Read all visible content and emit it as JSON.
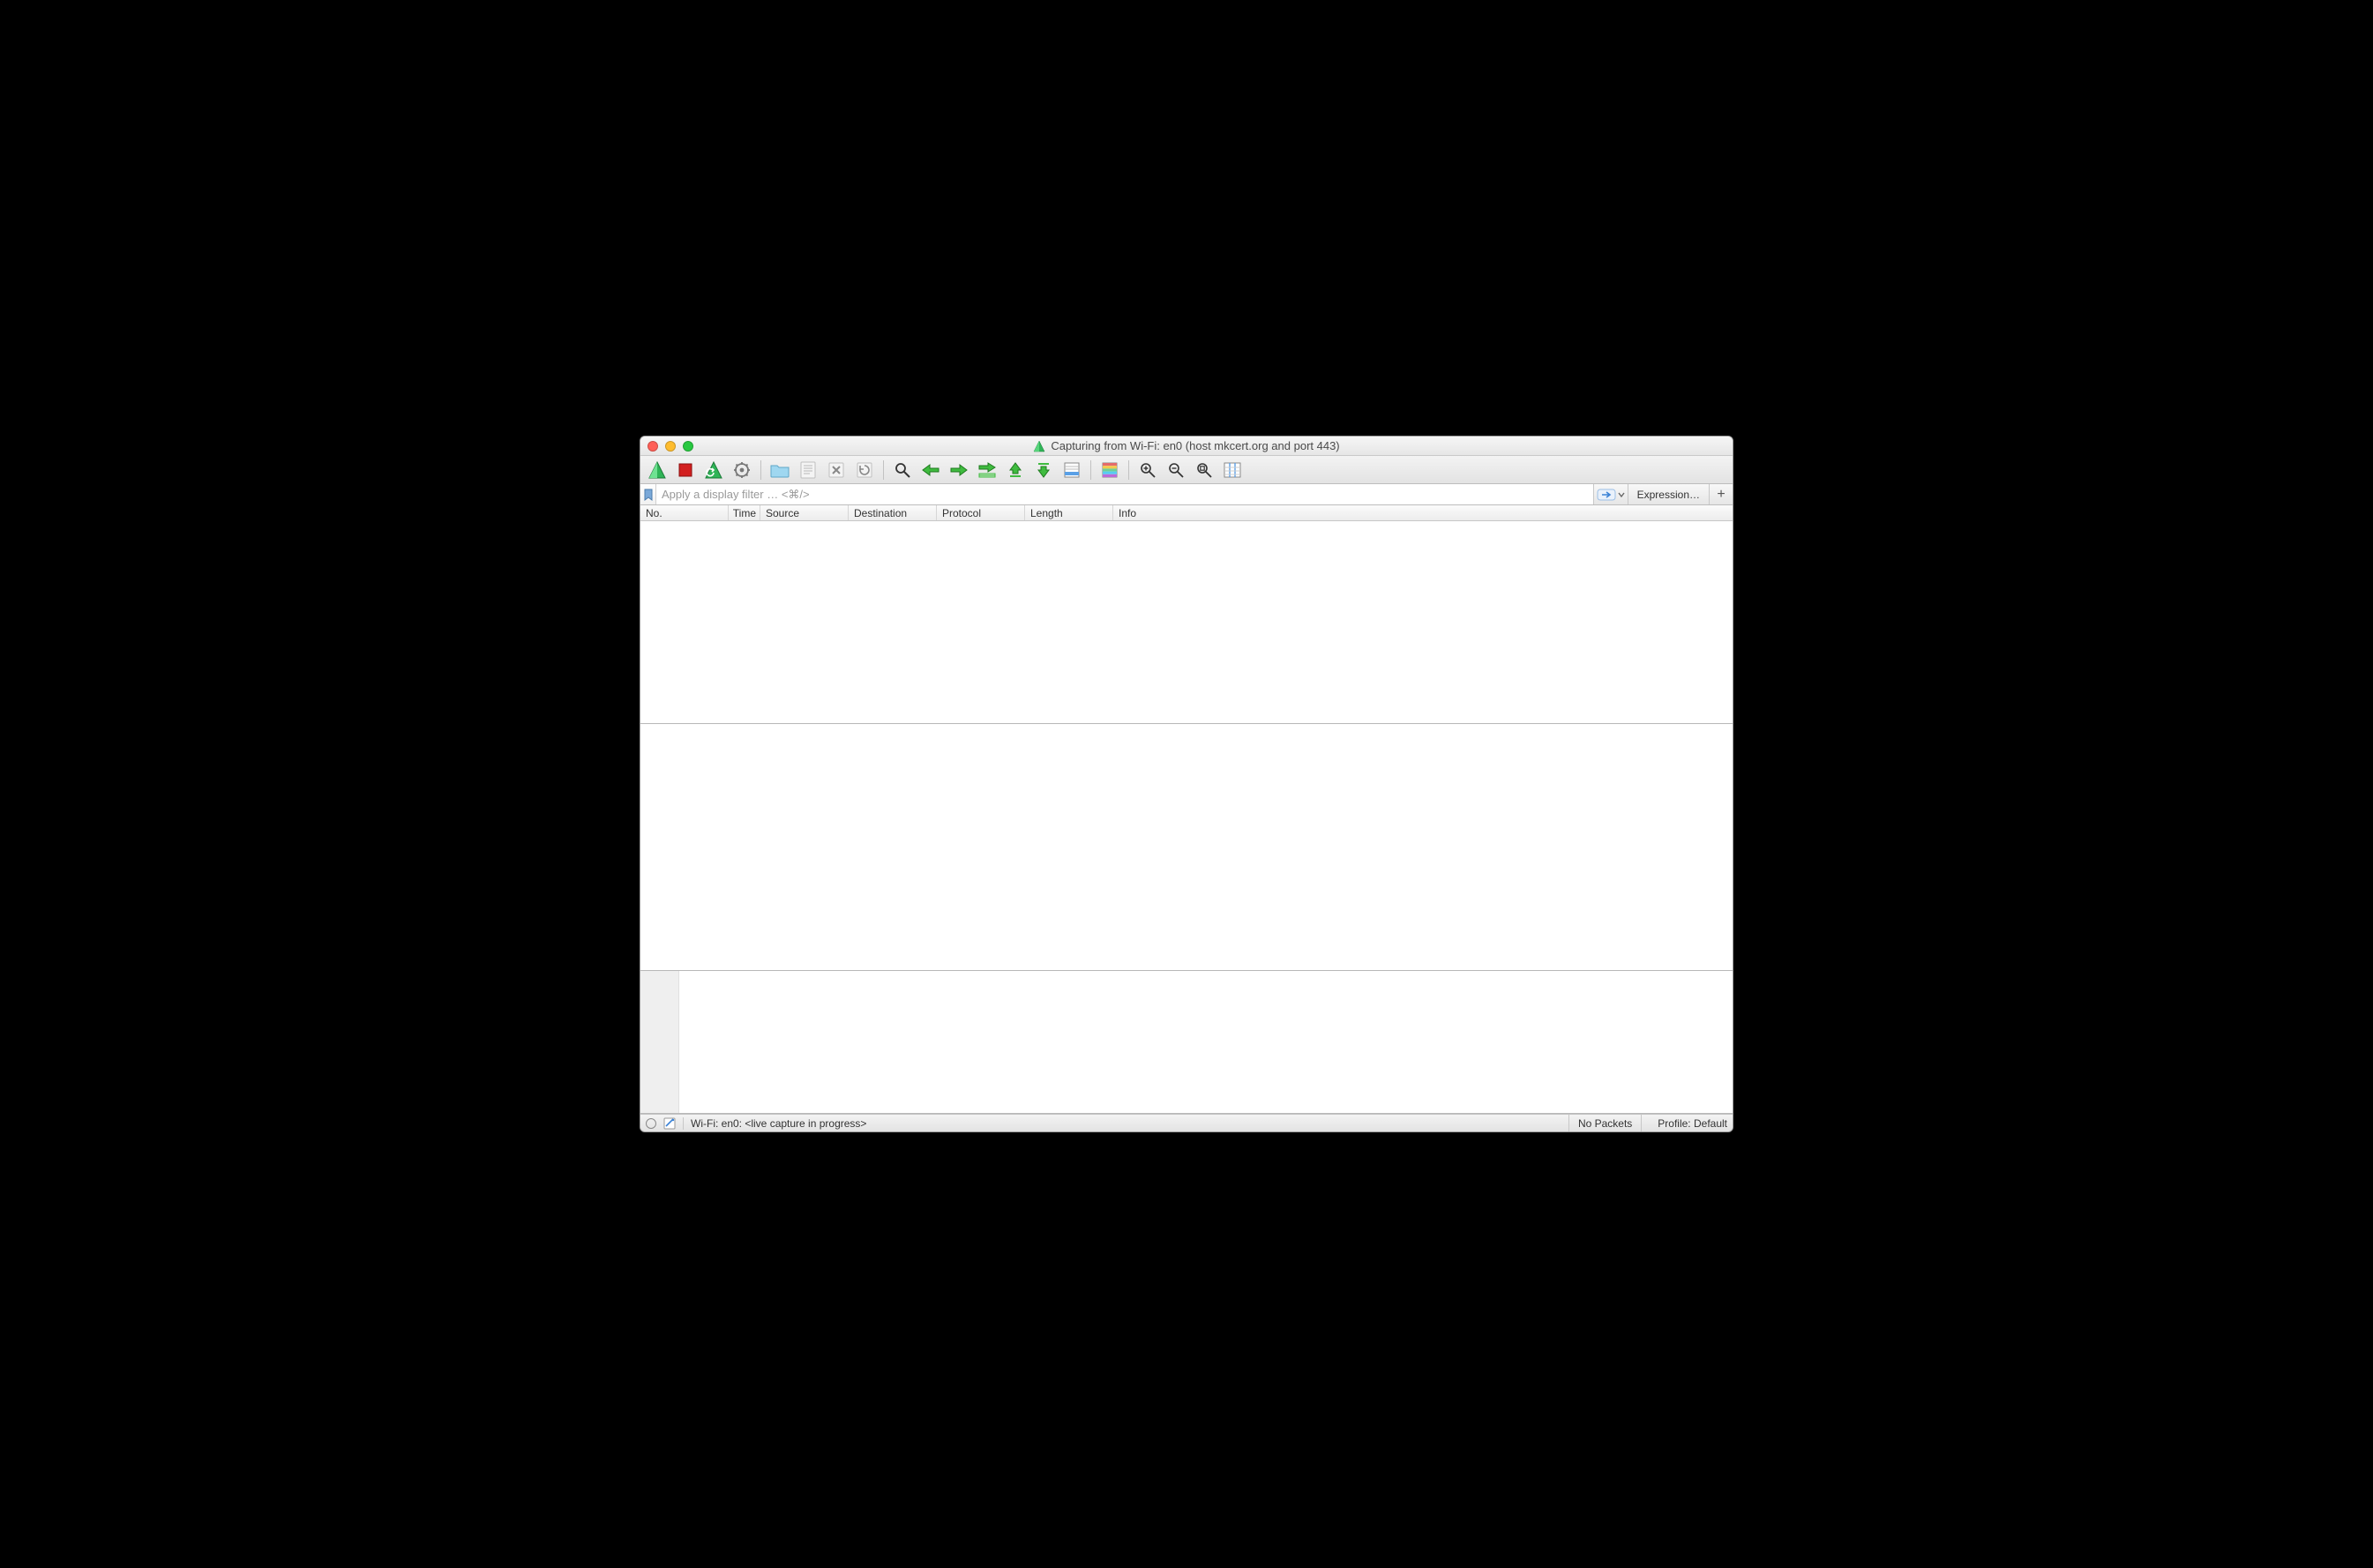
{
  "window": {
    "title": "Capturing from Wi-Fi: en0 (host mkcert.org and port 443)"
  },
  "toolbar": {
    "icons": {
      "start": "start-capture-icon",
      "stop": "stop-capture-icon",
      "restart": "restart-capture-icon",
      "options": "capture-options-icon",
      "open": "open-file-icon",
      "save": "save-file-icon",
      "close": "close-file-icon",
      "reload": "reload-file-icon",
      "find": "find-packet-icon",
      "prev": "go-prev-packet-icon",
      "next": "go-next-packet-icon",
      "jump": "go-to-packet-icon",
      "first": "go-first-packet-icon",
      "last": "go-last-packet-icon",
      "autoscroll": "autoscroll-icon",
      "colorize": "colorize-icon",
      "zoomin": "zoom-in-icon",
      "zoomout": "zoom-out-icon",
      "zoomreset": "zoom-reset-icon",
      "resizecols": "resize-columns-icon"
    }
  },
  "filterbar": {
    "placeholder": "Apply a display filter … <⌘/>",
    "value": "",
    "expression_label": "Expression…",
    "plus_label": "+"
  },
  "columns": {
    "no": "No.",
    "time": "Time",
    "source": "Source",
    "destination": "Destination",
    "protocol": "Protocol",
    "length": "Length",
    "info": "Info"
  },
  "statusbar": {
    "left": "Wi-Fi: en0: <live capture in progress>",
    "mid": "No Packets",
    "right": "Profile: Default"
  }
}
